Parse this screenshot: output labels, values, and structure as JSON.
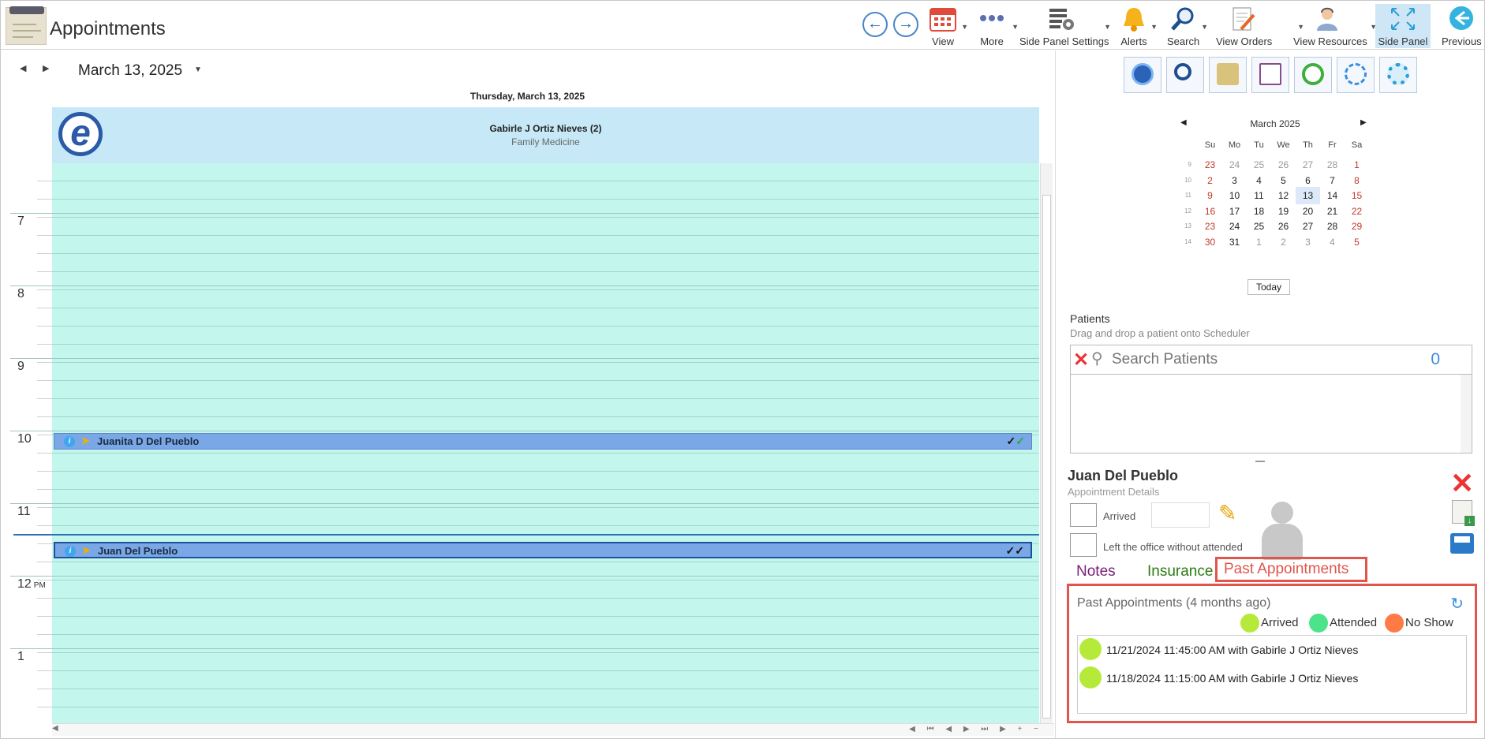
{
  "app": {
    "title": "Appointments"
  },
  "toolbar": {
    "items": [
      {
        "label": "View",
        "icon": "calendar-icon"
      },
      {
        "label": "More",
        "icon": "more-dots-icon"
      },
      {
        "label": "Side Panel Settings",
        "icon": "panel-settings-icon"
      },
      {
        "label": "Alerts",
        "icon": "bell-icon"
      },
      {
        "label": "Search",
        "icon": "search-icon"
      },
      {
        "label": "View Orders",
        "icon": "orders-icon"
      },
      {
        "label": "View Resources",
        "icon": "resources-icon"
      },
      {
        "label": "Side Panel",
        "icon": "expand-icon"
      },
      {
        "label": "Previous",
        "icon": "previous-arrow-icon"
      }
    ]
  },
  "calendar": {
    "date": "March 13, 2025",
    "day_header": "Thursday, March 13, 2025",
    "resource": {
      "name": "Gabirle J Ortiz Nieves (2)",
      "specialty": "Family Medicine"
    },
    "hours": [
      "7",
      "8",
      "9",
      "10",
      "11",
      "12",
      "1"
    ],
    "pm_marker": "PM",
    "appointments": [
      {
        "name": "Juanita D Del Pueblo",
        "checks": "✓✓"
      },
      {
        "name": "Juan Del Pueblo",
        "checks": "✓✓"
      }
    ]
  },
  "mini_calendar": {
    "month": "March 2025",
    "dow": [
      "Su",
      "Mo",
      "Tu",
      "We",
      "Th",
      "Fr",
      "Sa"
    ],
    "weeks": [
      {
        "wk": "9",
        "days": [
          "23",
          "24",
          "25",
          "26",
          "27",
          "28",
          "1"
        ]
      },
      {
        "wk": "10",
        "days": [
          "2",
          "3",
          "4",
          "5",
          "6",
          "7",
          "8"
        ]
      },
      {
        "wk": "11",
        "days": [
          "9",
          "10",
          "11",
          "12",
          "13",
          "14",
          "15"
        ]
      },
      {
        "wk": "12",
        "days": [
          "16",
          "17",
          "18",
          "19",
          "20",
          "21",
          "22"
        ]
      },
      {
        "wk": "13",
        "days": [
          "23",
          "24",
          "25",
          "26",
          "27",
          "28",
          "29"
        ]
      },
      {
        "wk": "14",
        "days": [
          "30",
          "31",
          "1",
          "2",
          "3",
          "4",
          "5"
        ]
      }
    ],
    "selected": "13",
    "today_label": "Today"
  },
  "patients": {
    "label": "Patients",
    "hint": "Drag and drop a patient onto Scheduler",
    "search_placeholder": "Search Patients",
    "count": "0"
  },
  "details": {
    "name": "Juan Del Pueblo",
    "subtitle": "Appointment Details",
    "arrived_label": "Arrived",
    "left_label": "Left the office without attended"
  },
  "tabs": {
    "notes": "Notes",
    "insurance": "Insurance",
    "past": "Past Appointments"
  },
  "past": {
    "title": "Past Appointments (4 months ago)",
    "legend": [
      {
        "label": "Arrived",
        "color": "#b6ea3a"
      },
      {
        "label": "Attended",
        "color": "#4de38a"
      },
      {
        "label": "No Show",
        "color": "#ff7a45"
      }
    ],
    "items": [
      "11/21/2024 11:45:00 AM with Gabirle J Ortiz Nieves",
      "11/18/2024 11:15:00 AM with Gabirle J Ortiz Nieves"
    ]
  }
}
